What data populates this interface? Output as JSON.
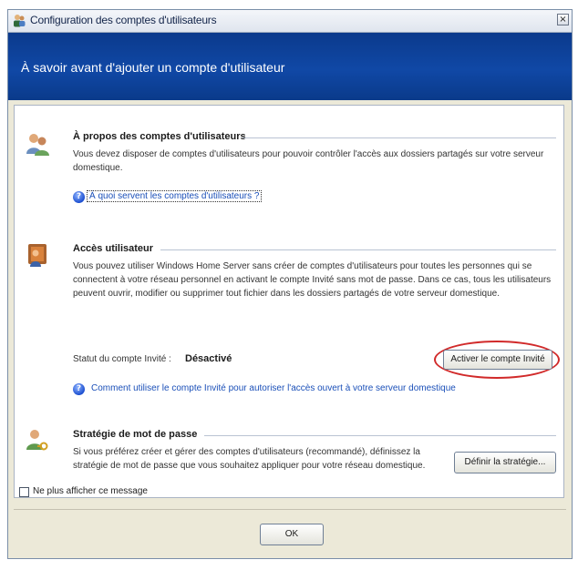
{
  "window": {
    "title": "Configuration des comptes d'utilisateurs",
    "close_label": "×"
  },
  "banner": {
    "title": "À savoir avant d'ajouter un compte d'utilisateur"
  },
  "sections": {
    "about": {
      "title": "À propos des comptes d'utilisateurs",
      "body": "Vous devez disposer de comptes d'utilisateurs pour pouvoir contrôler l'accès aux dossiers partagés sur votre serveur domestique.",
      "link": "À quoi servent les comptes d'utilisateurs ?"
    },
    "access": {
      "title": "Accès utilisateur",
      "body": "Vous pouvez utiliser Windows Home Server sans créer de comptes d'utilisateurs pour toutes les personnes qui se connectent à votre réseau personnel en activant le compte Invité sans mot de passe. Dans ce cas, tous les utilisateurs peuvent ouvrir, modifier ou supprimer tout fichier dans les dossiers partagés de votre serveur domestique.",
      "status_label": "Statut du compte Invité :",
      "status_value": "Désactivé",
      "activate_button": "Activer le compte Invité",
      "link": "Comment utiliser le compte Invité pour autoriser l'accès ouvert à votre serveur domestique"
    },
    "password": {
      "title": "Stratégie de mot de passe",
      "body": "Si vous préférez créer et gérer des comptes d'utilisateurs (recommandé), définissez la stratégie de mot de passe que vous souhaitez appliquer pour votre réseau domestique.",
      "define_button": "Définir la stratégie..."
    }
  },
  "footer": {
    "checkbox_label": "Ne plus afficher ce message",
    "checkbox_checked": false,
    "ok_button": "OK"
  },
  "colors": {
    "banner": "#0b3a8c",
    "highlight_oval": "#d12a2a",
    "link": "#1a4fb8"
  },
  "icons": {
    "title": "users-icon",
    "about": "users-pair-icon",
    "access": "user-access-icon",
    "password": "user-key-icon",
    "help": "help-icon"
  }
}
